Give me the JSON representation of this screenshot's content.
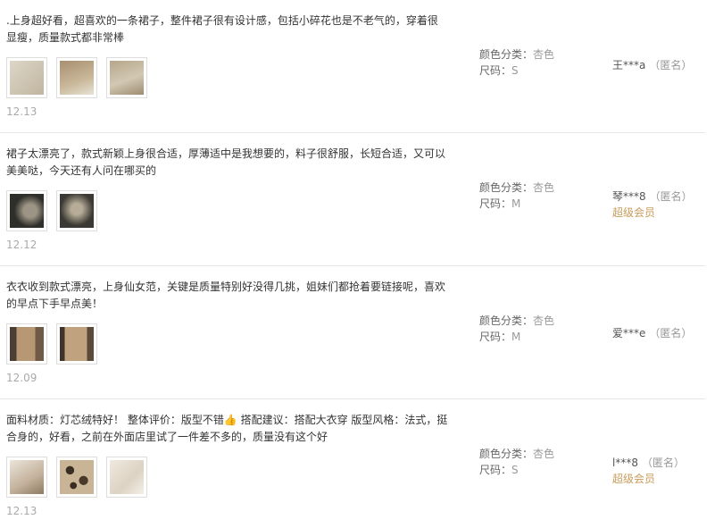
{
  "reviews": [
    {
      "text": ".上身超好看，超喜欢的一条裙子，整件裙子很有设计感，包括小碎花也是不老气的，穿着很显瘦，质量款式都非常棒",
      "date": "12.13",
      "color_label": "颜色分类：",
      "color_value": "杏色",
      "size_label": "尺码：",
      "size_value": "S",
      "user": "王***a",
      "anonymous": "（匿名）",
      "vip": "",
      "photos": [
        "#cfc6b4",
        "#b8a488",
        "#bfb39a"
      ]
    },
    {
      "text": "裙子太漂亮了，款式新颖上身很合适，厚薄适中是我想要的，料子很舒服，长短合适，又可以美美哒，今天还有人问在哪买的",
      "date": "12.12",
      "color_label": "颜色分类：",
      "color_value": "杏色",
      "size_label": "尺码：",
      "size_value": "M",
      "user": "琴***8",
      "anonymous": "（匿名）",
      "vip": "超级会员",
      "photos": [
        "#4a4a44",
        "#55524a"
      ]
    },
    {
      "text": "衣衣收到款式漂亮，上身仙女范，关键是质量特别好没得几挑，姐妹们都抢着要链接呢，喜欢的早点下手早点美！",
      "date": "12.09",
      "color_label": "颜色分类：",
      "color_value": "杏色",
      "size_label": "尺码：",
      "size_value": "M",
      "user": "爱***e",
      "anonymous": "（匿名）",
      "vip": "",
      "photos": [
        "#8c7358",
        "#a18364"
      ]
    },
    {
      "text": "面料材质：灯芯绒特好！ 整体评价：版型不错👍 搭配建议：搭配大衣穿 版型风格：法式，挺合身的，好看，之前在外面店里试了一件差不多的，质量没有这个好",
      "date": "12.13",
      "color_label": "颜色分类：",
      "color_value": "杏色",
      "size_label": "尺码：",
      "size_value": "S",
      "user": "l***8",
      "anonymous": "（匿名）",
      "vip": "超级会员",
      "photos": [
        "#cbbaa6",
        "#8a7356",
        "#e3dbcf"
      ]
    }
  ]
}
